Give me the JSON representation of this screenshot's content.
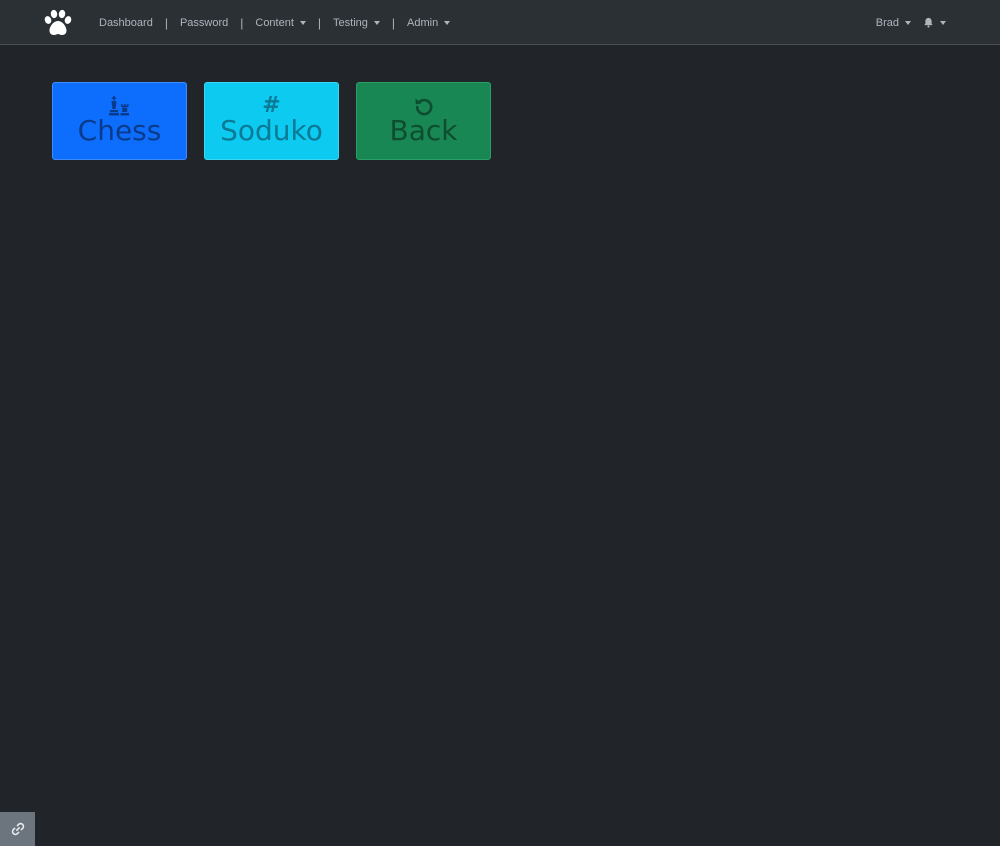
{
  "nav": {
    "brand_icon": "paw-icon",
    "links": [
      {
        "label": "Dashboard"
      },
      {
        "label": "Password"
      },
      {
        "label": "Content"
      },
      {
        "label": "Testing"
      },
      {
        "label": "Admin"
      }
    ],
    "separator": "|",
    "user_label": "Brad",
    "notifications_icon": "bell-icon"
  },
  "tiles": [
    {
      "label": "Chess",
      "icon": "chess-icon",
      "color": "#0d6efd"
    },
    {
      "label": "Soduko",
      "icon": "#",
      "color": "#0dcaf0"
    },
    {
      "label": "Back",
      "icon": "undo-icon",
      "color": "#198754"
    }
  ],
  "corner_button": {
    "icon": "link-icon",
    "color": "#6c757d"
  },
  "colors": {
    "background": "#212529",
    "navbar": "#2b3035",
    "nav_text": "#adb5bd"
  }
}
